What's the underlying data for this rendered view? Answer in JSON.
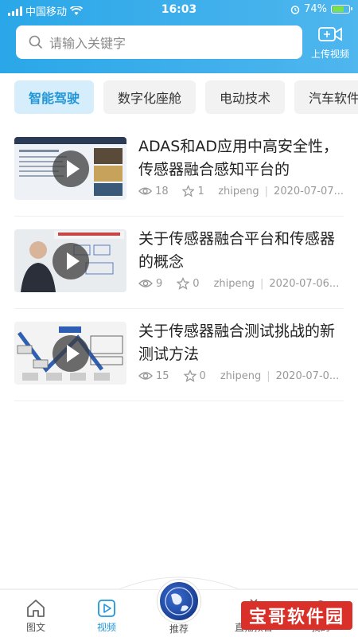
{
  "status_bar": {
    "carrier": "中国移动",
    "time": "16:03",
    "battery_pct": "74%",
    "battery_level": 0.74
  },
  "search": {
    "placeholder": "请输入关键字",
    "upload_label": "上传视频"
  },
  "tabs": [
    {
      "label": "智能驾驶",
      "active": true
    },
    {
      "label": "数字化座舱",
      "active": false
    },
    {
      "label": "电动技术",
      "active": false
    },
    {
      "label": "汽车软件",
      "active": false
    }
  ],
  "videos": [
    {
      "title": "ADAS和AD应用中高安全性，传感器融合感知平台的",
      "views": "18",
      "stars": "1",
      "author": "zhipeng",
      "date": "2020-07-07..."
    },
    {
      "title": "关于传感器融合平台和传感器的概念",
      "views": "9",
      "stars": "0",
      "author": "zhipeng",
      "date": "2020-07-06..."
    },
    {
      "title": "关于传感器融合测试挑战的新测试方法",
      "views": "15",
      "stars": "0",
      "author": "zhipeng",
      "date": "2020-07-0..."
    }
  ],
  "bottom_nav": {
    "items": [
      {
        "label": "图文",
        "icon": "house-icon"
      },
      {
        "label": "视频",
        "icon": "video-play-icon",
        "active": true
      },
      {
        "label": "推荐",
        "icon": "globe-icon"
      },
      {
        "label": "直播预告",
        "icon": "tv-icon"
      },
      {
        "label": "我的",
        "icon": "user-icon"
      }
    ]
  },
  "watermark": "宝哥软件园",
  "colors": {
    "accent": "#2196d8",
    "header": "#2aa7e8",
    "watermark_bg": "#d9302a"
  }
}
